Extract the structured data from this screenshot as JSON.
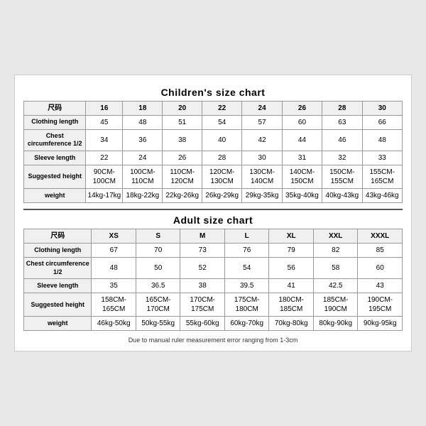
{
  "children_chart": {
    "title": "Children's size chart",
    "headers": [
      "尺码",
      "16",
      "18",
      "20",
      "22",
      "24",
      "26",
      "28",
      "30"
    ],
    "rows": [
      {
        "label": "Clothing length",
        "values": [
          "45",
          "48",
          "51",
          "54",
          "57",
          "60",
          "63",
          "66"
        ]
      },
      {
        "label": "Chest circumference 1/2",
        "values": [
          "34",
          "36",
          "38",
          "40",
          "42",
          "44",
          "46",
          "48"
        ]
      },
      {
        "label": "Sleeve length",
        "values": [
          "22",
          "24",
          "26",
          "28",
          "30",
          "31",
          "32",
          "33"
        ]
      },
      {
        "label": "Suggested height",
        "values": [
          "90CM-100CM",
          "100CM-110CM",
          "110CM-120CM",
          "120CM-130CM",
          "130CM-140CM",
          "140CM-150CM",
          "150CM-155CM",
          "155CM-165CM"
        ]
      },
      {
        "label": "weight",
        "values": [
          "14kg-17kg",
          "18kg-22kg",
          "22kg-26kg",
          "26kg-29kg",
          "29kg-35kg",
          "35kg-40kg",
          "40kg-43kg",
          "43kg-46kg"
        ]
      }
    ]
  },
  "adult_chart": {
    "title": "Adult size chart",
    "headers": [
      "尺码",
      "XS",
      "S",
      "M",
      "L",
      "XL",
      "XXL",
      "XXXL"
    ],
    "rows": [
      {
        "label": "Clothing length",
        "values": [
          "67",
          "70",
          "73",
          "76",
          "79",
          "82",
          "85"
        ]
      },
      {
        "label": "Chest circumference 1/2",
        "values": [
          "48",
          "50",
          "52",
          "54",
          "56",
          "58",
          "60"
        ]
      },
      {
        "label": "Sleeve length",
        "values": [
          "35",
          "36.5",
          "38",
          "39.5",
          "41",
          "42.5",
          "43"
        ]
      },
      {
        "label": "Suggested height",
        "values": [
          "158CM-165CM",
          "165CM-170CM",
          "170CM-175CM",
          "175CM-180CM",
          "180CM-185CM",
          "185CM-190CM",
          "190CM-195CM"
        ]
      },
      {
        "label": "weight",
        "values": [
          "46kg-50kg",
          "50kg-55kg",
          "55kg-60kg",
          "60kg-70kg",
          "70kg-80kg",
          "80kg-90kg",
          "90kg-95kg"
        ]
      }
    ]
  },
  "footer": {
    "note": "Due to manual ruler measurement error ranging from 1-3cm"
  }
}
